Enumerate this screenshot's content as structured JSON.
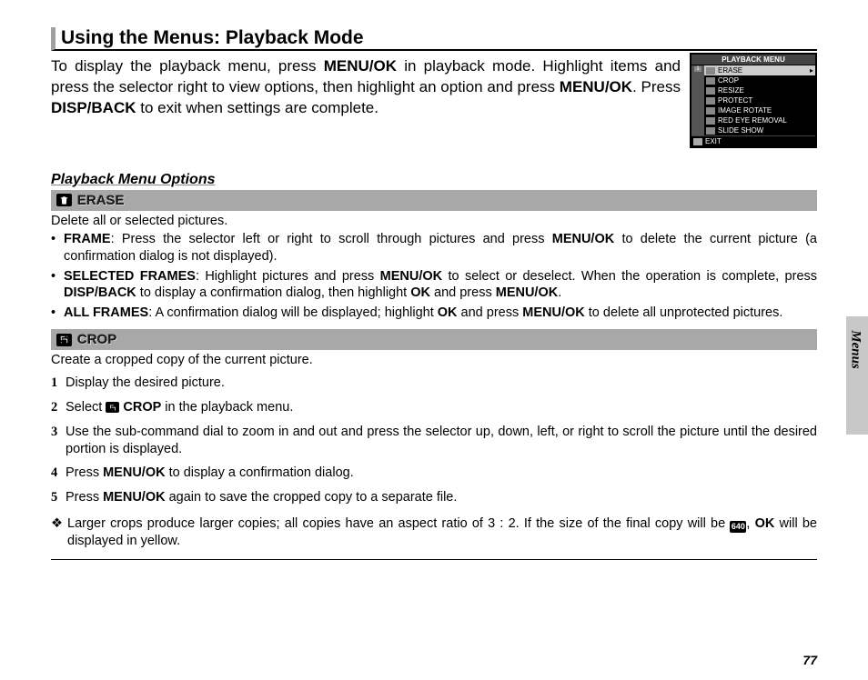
{
  "title": "Using the Menus: Playback Mode",
  "intro": {
    "part1": "To display the playback menu, press ",
    "menuok": "MENU/OK",
    "part2": " in playback mode.  Highlight items and press the selector right to view options, then highlight an option and press ",
    "part3": ".  Press ",
    "dispback": "DISP/BACK",
    "part4": " to exit when settings are complete."
  },
  "screenshot": {
    "title": "PLAYBACK MENU",
    "tab": "1",
    "items": [
      "ERASE",
      "CROP",
      "RESIZE",
      "PROTECT",
      "IMAGE ROTATE",
      "RED EYE REMOVAL",
      "SLIDE SHOW"
    ],
    "exit": "EXIT"
  },
  "subheading": "Playback Menu Options",
  "erase": {
    "title": "ERASE",
    "desc": "Delete all or selected pictures.",
    "b1": {
      "label": "FRAME",
      "text1": ": Press the selector left or right to scroll through pictures and press ",
      "menuok": "MENU/OK",
      "text2": " to delete the current picture (a confirmation dialog is not displayed)."
    },
    "b2": {
      "label": "SELECTED FRAMES",
      "text1": ": Highlight pictures and press ",
      "menuok": "MENU/OK",
      "text2": " to select or deselect.  When the operation is complete, press ",
      "dispback": "DISP/BACK",
      "text3": " to display a confirmation dialog, then highlight ",
      "ok": "OK",
      "text4": " and press ",
      "text5": "."
    },
    "b3": {
      "label": "ALL FRAMES",
      "text1": ": A confirmation dialog will be displayed; highlight ",
      "ok": "OK",
      "text2": " and press ",
      "menuok": "MENU/OK",
      "text3": " to delete all unprotected pictures."
    }
  },
  "crop": {
    "title": "CROP",
    "desc": "Create a cropped copy of the current picture.",
    "s1": "Display the desired picture.",
    "s2a": "Select ",
    "s2b": " CROP",
    "s2c": " in the playback menu.",
    "s3": "Use the sub-command dial to zoom in and out and press the selector up, down, left, or right to scroll the picture until the desired portion is displayed.",
    "s4a": "Press ",
    "s4b": "MENU/OK",
    "s4c": " to display a confirmation dialog.",
    "s5a": "Press ",
    "s5b": "MENU/OK",
    "s5c": " again to save the cropped copy to a separate file.",
    "note1": "Larger crops produce larger copies; all copies have an aspect ratio of 3 : 2.  If the size of the final copy will be ",
    "notesize": "640",
    "note2": ", ",
    "noteok": "OK",
    "note3": " will be displayed in yellow."
  },
  "side": "Menus",
  "pagenum": "77"
}
